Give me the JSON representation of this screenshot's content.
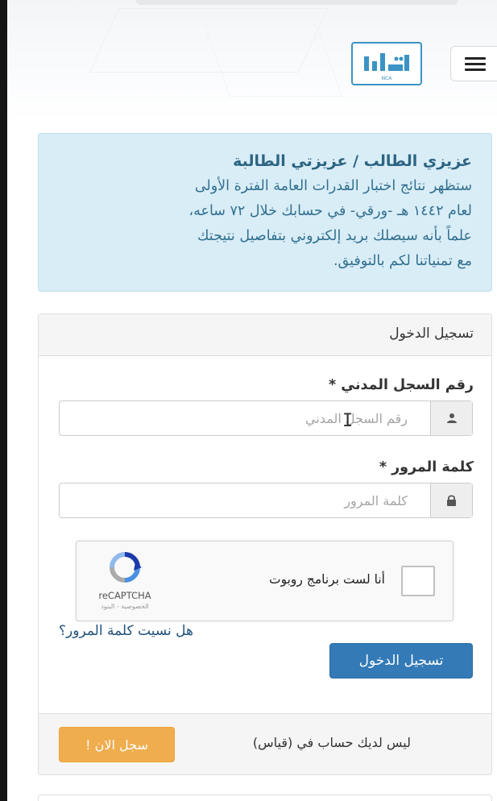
{
  "header": {
    "menu_icon": "hamburger-icon",
    "logo_text": "قياس",
    "logo_subtext": "NCA"
  },
  "alert": {
    "title": "عزيزي الطالب / عزيزتي الطالبة",
    "lines": [
      "ستظهر نتائج اختبار القدرات العامة الفترة الأولى",
      "لعام ١٤٤٢ هـ -ورقي- في حسابك خلال ٧٢ ساعه،",
      "علماً بأنه سيصلك بريد إلكتروني بتفاصيل نتيجتك",
      "مع تمنياتنا لكم بالتوفيق."
    ]
  },
  "login": {
    "heading": "تسجيل الدخول",
    "national_id": {
      "label": "رقم السجل المدني *",
      "placeholder": "رقم السجل المدني",
      "value": "",
      "icon": "user-icon"
    },
    "password": {
      "label": "كلمة المرور *",
      "placeholder": "كلمة المرور",
      "value": "",
      "icon": "lock-icon"
    },
    "captcha": {
      "label": "أنا لست برنامج روبوت",
      "brand": "reCAPTCHA",
      "terms": "الخصوصية - البنود",
      "checked": false
    },
    "forgot_password": "هل نسيت كلمة المرور؟",
    "submit_label": "تسجيل الدخول"
  },
  "footer": {
    "no_account_text": "ليس لديك حساب في (قياس)",
    "signup_label": "سجل الان !"
  },
  "colors": {
    "alert_bg": "#d9edf7",
    "alert_text": "#31708f",
    "primary": "#337ab7",
    "warning": "#f0ad4e",
    "logo_blue": "#3a93c4"
  }
}
